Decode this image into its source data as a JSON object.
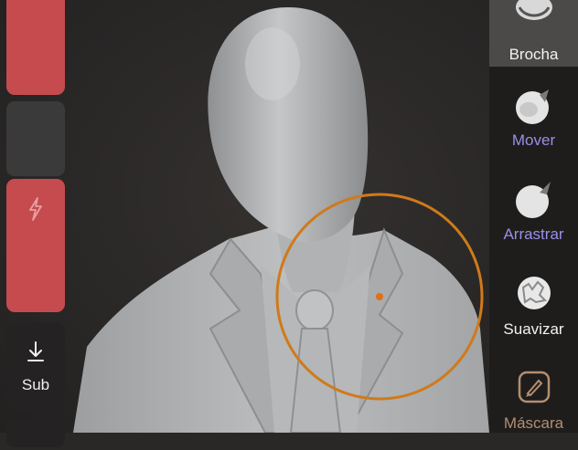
{
  "left_toolbar": {
    "sub_label": "Sub"
  },
  "right_toolbar": {
    "tools": [
      {
        "label": "Brocha",
        "icon": "brush-sphere-icon",
        "selected": true
      },
      {
        "label": "Mover",
        "icon": "move-sphere-icon",
        "selected": false
      },
      {
        "label": "Arrastrar",
        "icon": "drag-sphere-icon",
        "selected": false
      },
      {
        "label": "Suavizar",
        "icon": "smooth-sphere-icon",
        "selected": false
      },
      {
        "label": "Máscara",
        "icon": "mask-brush-icon",
        "selected": false
      }
    ]
  },
  "colors": {
    "accent_red": "#c64b4e",
    "cursor_orange": "#d07a1a",
    "label_purple": "#9a8fe6",
    "label_tan": "#b38e70"
  }
}
